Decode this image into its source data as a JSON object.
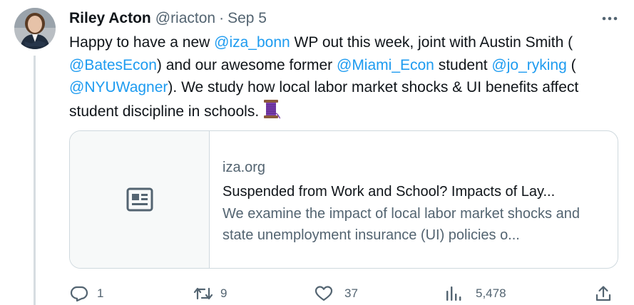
{
  "tweet": {
    "author": {
      "name": "Riley Acton",
      "handle": "@riacton"
    },
    "separator": "·",
    "date": "Sep 5",
    "text": [
      {
        "type": "text",
        "value": "Happy to have a new "
      },
      {
        "type": "mention",
        "value": "@iza_bonn"
      },
      {
        "type": "text",
        "value": " WP out this week, joint with Austin Smith ("
      },
      {
        "type": "mention",
        "value": "@BatesEcon"
      },
      {
        "type": "text",
        "value": ") and our awesome former "
      },
      {
        "type": "mention",
        "value": "@Miami_Econ"
      },
      {
        "type": "text",
        "value": " student "
      },
      {
        "type": "mention",
        "value": "@jo_ryking"
      },
      {
        "type": "text",
        "value": " ("
      },
      {
        "type": "mention",
        "value": "@NYUWagner"
      },
      {
        "type": "text",
        "value": "). We study how local labor market shocks & UI benefits affect student discipline in schools."
      }
    ],
    "emoji_icon": "thread-spool-emoji"
  },
  "card": {
    "domain": "iza.org",
    "title": "Suspended from Work and School? Impacts of Lay...",
    "description": "We examine the impact of local labor market shocks and state unemployment insurance (UI) policies o...",
    "thumbnail_icon": "article-icon"
  },
  "actions": {
    "reply": {
      "icon": "reply-icon",
      "count": "1"
    },
    "retweet": {
      "icon": "retweet-icon",
      "count": "9"
    },
    "like": {
      "icon": "heart-icon",
      "count": "37"
    },
    "views": {
      "icon": "views-icon",
      "count": "5,478"
    },
    "share": {
      "icon": "share-icon"
    }
  },
  "colors": {
    "link": "#1d9bf0",
    "secondary_text": "#536471",
    "primary_text": "#0f1419",
    "border": "#cfd9de",
    "thread_line": "#d7dde1"
  }
}
